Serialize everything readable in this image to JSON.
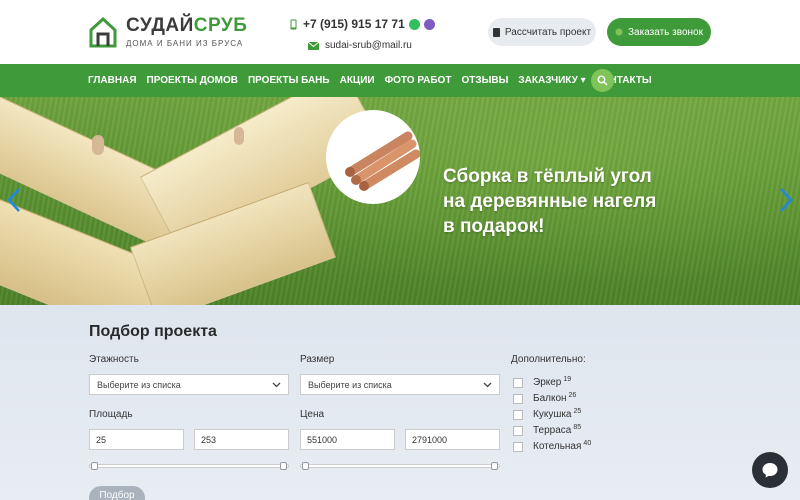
{
  "header": {
    "logo_title_part1": "СУДАЙ",
    "logo_title_part2": "СРУБ",
    "logo_subtitle": "ДОМА И БАНИ ИЗ БРУСА",
    "phone": "+7 (915) 915 17 71",
    "email": "sudai-srub@mail.ru",
    "calc_button": "Рассчитать проект",
    "call_button": "Заказать звонок"
  },
  "nav": {
    "items": [
      {
        "label": "ГЛАВНАЯ"
      },
      {
        "label": "ПРОЕКТЫ ДОМОВ"
      },
      {
        "label": "ПРОЕКТЫ БАНЬ"
      },
      {
        "label": "АКЦИИ"
      },
      {
        "label": "ФОТО РАБОТ"
      },
      {
        "label": "ОТЗЫВЫ"
      },
      {
        "label": "ЗАКАЗЧИКУ ▾"
      },
      {
        "label": "КОНТАКТЫ"
      }
    ]
  },
  "hero": {
    "line1": "Сборка в тёплый угол",
    "line2": "на деревянные нагеля",
    "line3": "в подарок!"
  },
  "filter": {
    "title": "Подбор проекта",
    "floors_label": "Этажность",
    "floors_value": "Выберите из списка",
    "size_label": "Размер",
    "size_value": "Выберите из списка",
    "area_label": "Площадь",
    "area_min": "25",
    "area_max": "253",
    "price_label": "Цена",
    "price_min": "551000",
    "price_max": "2791000",
    "extra_label": "Дополнительно:",
    "options": [
      {
        "label": "Эркер",
        "count": "19"
      },
      {
        "label": "Балкон",
        "count": "26"
      },
      {
        "label": "Кукушка",
        "count": "25"
      },
      {
        "label": "Терраса",
        "count": "85"
      },
      {
        "label": "Котельная",
        "count": "40"
      }
    ],
    "submit_button": "Подбор"
  },
  "colors": {
    "brand_green": "#3f9a3a",
    "light_green": "#7fc459",
    "dark": "#2b2f36"
  }
}
